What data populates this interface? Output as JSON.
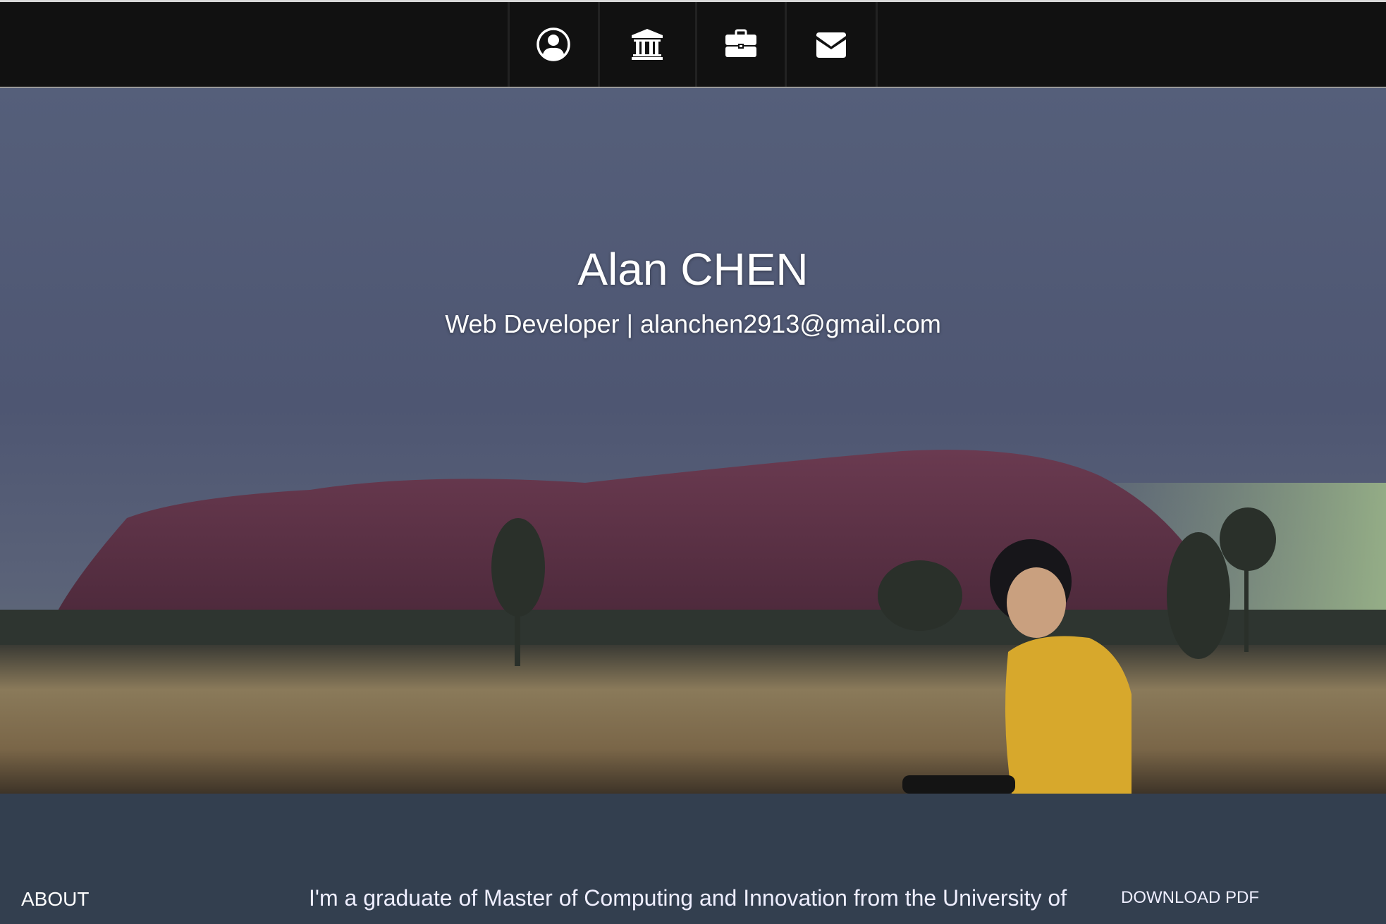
{
  "nav": {
    "items": [
      {
        "icon": "user-circle-icon"
      },
      {
        "icon": "university-icon"
      },
      {
        "icon": "briefcase-icon"
      },
      {
        "icon": "envelope-icon"
      }
    ]
  },
  "hero": {
    "name": "Alan CHEN",
    "subtitle": "Web Developer | alanchen2913@gmail.com"
  },
  "about": {
    "label": "ABOUT",
    "text": "I'm a graduate of Master of Computing and Innovation from the University of",
    "download_label": "DOWNLOAD PDF"
  }
}
